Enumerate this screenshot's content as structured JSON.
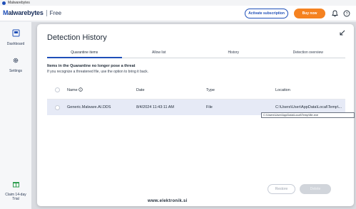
{
  "window": {
    "title": "Malwarebytes"
  },
  "header": {
    "logo_text_prefix": "M",
    "logo_text_rest": "alwarebytes",
    "edition": "Free",
    "activate_label": "Activate subscription",
    "buy_label": "Buy now",
    "accent": "#1f4fb8",
    "buy_color": "#f58220"
  },
  "sidebar": {
    "items": [
      {
        "label": "Dashboard",
        "icon": "dashboard-icon"
      },
      {
        "label": "Settings",
        "icon": "gear-icon"
      }
    ],
    "bottom": {
      "label": "Claim 14-day Trial",
      "icon": "gift-icon"
    }
  },
  "dialog": {
    "title": "Detection History",
    "tabs": [
      {
        "label": "Quarantine items",
        "active": true
      },
      {
        "label": "Allow list",
        "active": false
      },
      {
        "label": "History",
        "active": false
      },
      {
        "label": "Detection overview",
        "active": false
      }
    ],
    "section_heading": "Items in the Quarantine no longer pose a threat",
    "section_subtext": "If you recognize a threatened file, use the option to bring it back.",
    "columns": {
      "name": "Name",
      "date": "Date",
      "type": "Type",
      "location": "Location"
    },
    "rows": [
      {
        "name": "Generic.Malware.AI.DDS",
        "date": "8/4/2024 11:43:11 AM",
        "type": "File",
        "location": "C:\\Users\\User\\AppData\\Local\\Temp\\..."
      }
    ],
    "tooltip": "C:\\Users\\User\\AppData\\Local\\Temp\\file.exe",
    "restore_label": "Restore",
    "delete_label": "Delete"
  },
  "watermark": "www.elektronik.si"
}
